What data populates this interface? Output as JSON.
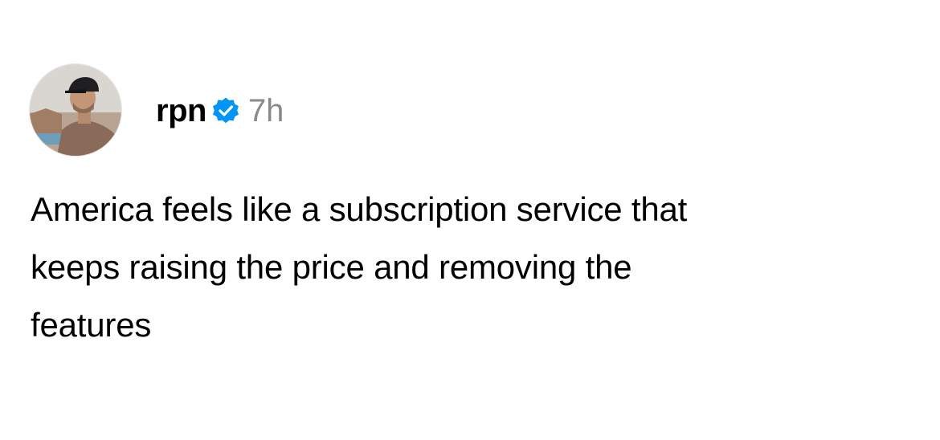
{
  "post": {
    "username": "rpn",
    "verified_icon": "verified-badge-icon",
    "timestamp": "7h",
    "text_lines": [
      "America feels like a subscription service that",
      "keeps raising the price and removing the",
      "features"
    ]
  },
  "colors": {
    "verified_blue": "#0095f6",
    "timestamp_gray": "#8a8a8a",
    "text": "#000000",
    "background": "#ffffff"
  }
}
